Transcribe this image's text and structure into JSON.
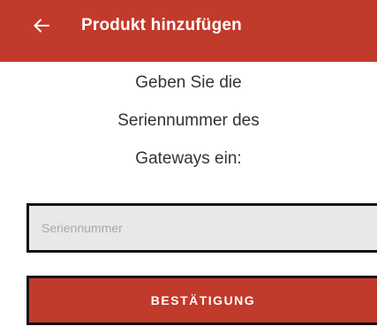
{
  "app_bar": {
    "title": "Produkt hinzufügen",
    "back_icon": "arrow-left-icon",
    "background_color": "#c23a2c"
  },
  "instruction": {
    "lines": [
      "Geben Sie die",
      "Seriennummer des",
      "Gateways ein:"
    ]
  },
  "serial_input": {
    "placeholder": "Seriennummer",
    "value": ""
  },
  "confirm_button": {
    "label": "BESTÄTIGUNG"
  }
}
